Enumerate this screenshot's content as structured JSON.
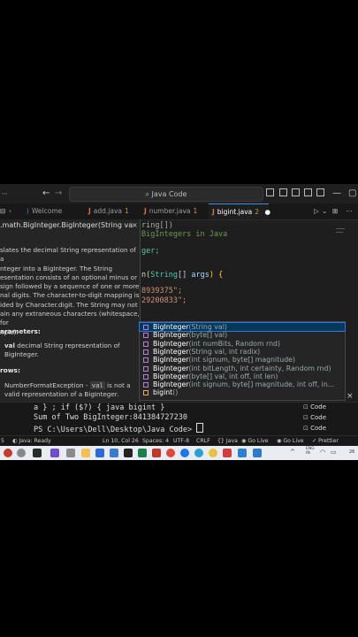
{
  "titlebar": {
    "back": "←",
    "forward": "→",
    "search": "Java Code"
  },
  "tabs": [
    {
      "label": "Welcome",
      "badge": ""
    },
    {
      "label": "add.java",
      "badge": "1"
    },
    {
      "label": "number.java",
      "badge": "1"
    },
    {
      "label": "bigint.java",
      "badge": "2"
    }
  ],
  "hover": {
    "signature": ".math.BigInteger.BigInteger(String va",
    "desc": [
      "slates the decimal String representation of a",
      "nteger into a BigInteger. The String",
      "esentation consists of an optional minus or",
      "sign followed by a sequence of one or more",
      "nal digits. The character-to-digit mapping is",
      "ided by Character.digit. The String may not",
      "ain any extraneous characters (whitespace, for",
      "nple)."
    ],
    "params_heading": "arameters:",
    "param_name": "val",
    "param_desc_1": "decimal String representation of",
    "param_desc_2": "BigInteger.",
    "throws_heading": "rows:",
    "throws_1a": "NumberFormatException -",
    "throws_1b": "val",
    "throws_1c": "is not a",
    "throws_2": "valid representation of a BigInteger."
  },
  "editor": {
    "line1": "ring[])",
    "line2": "BigIntegers in Java",
    "line3": "ger;",
    "line4a": "n(",
    "line4b": "String",
    "line4c": "[]",
    "line4d": "args",
    "line4e": ") {",
    "line5": "8939375\";",
    "line6": "29200833\";"
  },
  "suggest": [
    {
      "name": "BigInteger",
      "args": "(String val)"
    },
    {
      "name": "BigInteger",
      "args": "(byte[] val)"
    },
    {
      "name": "BigInteger",
      "args": "(int numBits, Random rnd)"
    },
    {
      "name": "BigInteger",
      "args": "(String val, int radix)"
    },
    {
      "name": "BigInteger",
      "args": "(int signum, byte[] magnitude)"
    },
    {
      "name": "BigInteger",
      "args": "(int bitLength, int certainty, Random rnd)"
    },
    {
      "name": "BigInteger",
      "args": "(byte[] val, int off, int len)"
    },
    {
      "name": "BigInteger",
      "args": "(int signum, byte[] magnitude, int off, in..."
    },
    {
      "name": "bigint",
      "args": "()"
    }
  ],
  "terminal": {
    "line1": "a } ; if ($?) { java bigint }",
    "line2": "Sum of Two BigInteger:841384727230",
    "line3": "PS C:\\Users\\Dell\\Desktop\\Java Code>",
    "list": [
      "Code",
      "Code",
      "Code"
    ]
  },
  "status": {
    "java": "Java: Ready",
    "position": "Ln 10, Col 26",
    "spaces": "Spaces: 4",
    "encoding": "UTF-8",
    "eol": "CRLF",
    "language": "{} Java",
    "golive1": "Go Live",
    "golive2": "Go Live",
    "prettier": "Prettier"
  },
  "taskbar": {
    "lang_top": "ENG",
    "lang_bot": "IN",
    "time": "26"
  },
  "colors": {
    "accent": "#3c8fe0",
    "keyword_green": "#6a9955",
    "string_orange": "#ce9178",
    "type_teal": "#4ec9b0",
    "param_blue": "#9cdcfe"
  }
}
